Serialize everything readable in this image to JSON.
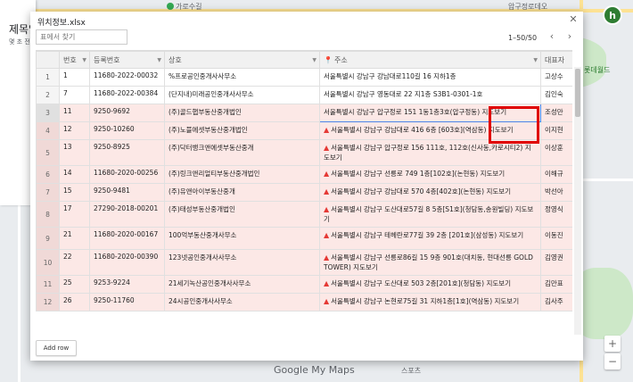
{
  "map": {
    "labels": [
      "가로수길",
      "압구정로데오",
      "롯데월드",
      "스포츠"
    ],
    "left_panel_title": "제목없",
    "left_panel_sub": "몇 초 전",
    "logo": "Google My Maps",
    "avatar_letter": "h",
    "zoom_in": "+",
    "zoom_out": "−"
  },
  "dialog": {
    "title": "위치정보.xlsx",
    "search_placeholder": "표에서 찾기",
    "pager_text": "1–50/50",
    "add_row_label": "Add row",
    "columns": [
      "번호",
      "등록번호",
      "상호",
      "주소",
      "대표자"
    ],
    "rows": [
      {
        "row": "1",
        "num": "1",
        "reg": "11680-2022-00032",
        "name": "%프로공인중개사사무소",
        "addr": "서울특별시 강남구 강남대로110길 16 지하1층",
        "rep": "고상수",
        "warn": false,
        "hl": false
      },
      {
        "row": "2",
        "num": "7",
        "reg": "11680-2022-00384",
        "name": "(단지내)미래공인중개사사무소",
        "addr": "서울특별시 강남구 영동대로 22 지1층 S3B1-0301-1호",
        "rep": "김인숙",
        "warn": false,
        "hl": false
      },
      {
        "row": "3",
        "num": "11",
        "reg": "9250-9692",
        "name": "(주)골드햅부동산중개법인",
        "addr": "서울특별시 강남구 압구정로 151 1동1층3호(압구정동) 지도보기",
        "rep": "조성만",
        "warn": false,
        "hl": true,
        "sel": true
      },
      {
        "row": "4",
        "num": "12",
        "reg": "9250-10260",
        "name": "(주)노블에셋부동산중개법인",
        "addr": "서울특별시 강남구 강남대로 416 6층 [603호](역삼동) 지도보기",
        "rep": "이지현",
        "warn": true,
        "hl": true
      },
      {
        "row": "5",
        "num": "13",
        "reg": "9250-8925",
        "name": "(주)닥터뱅크앤에셋부동산중개",
        "addr": "서울특별시 강남구 압구정로 156 111호, 112호(신사동,카로시티2) 지도보기",
        "rep": "이상훈",
        "warn": true,
        "hl": true
      },
      {
        "row": "6",
        "num": "14",
        "reg": "11680-2020-00256",
        "name": "(주)링크앤리얼티부동산중개법인",
        "addr": "서울특별시 강남구 선릉로 749 1층[102호](논현동) 지도보기",
        "rep": "이해규",
        "warn": true,
        "hl": true
      },
      {
        "row": "7",
        "num": "15",
        "reg": "9250-9481",
        "name": "(주)유앤아이부동산중개",
        "addr": "서울특별시 강남구 강남대로 570 4층[402호](논현동) 지도보기",
        "rep": "박선아",
        "warn": true,
        "hl": true
      },
      {
        "row": "8",
        "num": "17",
        "reg": "27290-2018-00201",
        "name": "(주)태성부동산중개법인",
        "addr": "서울특별시 강남구 도산대로57길 8 5층[S1호](청담동,송원빌딩) 지도보기",
        "rep": "정영식",
        "warn": true,
        "hl": true
      },
      {
        "row": "9",
        "num": "21",
        "reg": "11680-2020-00167",
        "name": "100억부동산중개사무소",
        "addr": "서울특별시 강남구 테헤란로77길 39 2층 [201호](삼성동) 지도보기",
        "rep": "이동진",
        "warn": true,
        "hl": true
      },
      {
        "row": "10",
        "num": "22",
        "reg": "11680-2020-00390",
        "name": "123넷공인중개사사무소",
        "addr": "서울특별시 강남구 선릉로86길 15 9층 901호(대치동, 현대선릉 GOLD TOWER) 지도보기",
        "rep": "김영권",
        "warn": true,
        "hl": true
      },
      {
        "row": "11",
        "num": "25",
        "reg": "9253-9224",
        "name": "21세기녹산공인중개사사무소",
        "addr": "서울특별시 강남구 도산대로 503 2층[201호](청담동) 지도보기",
        "rep": "김만표",
        "warn": true,
        "hl": true
      },
      {
        "row": "12",
        "num": "26",
        "reg": "9250-11760",
        "name": "24시공인중개사사무소",
        "addr": "서울특별시 강남구 논현로75길 31 지하1층[1호](역삼동) 지도보기",
        "rep": "김사주",
        "warn": true,
        "hl": true
      }
    ]
  }
}
